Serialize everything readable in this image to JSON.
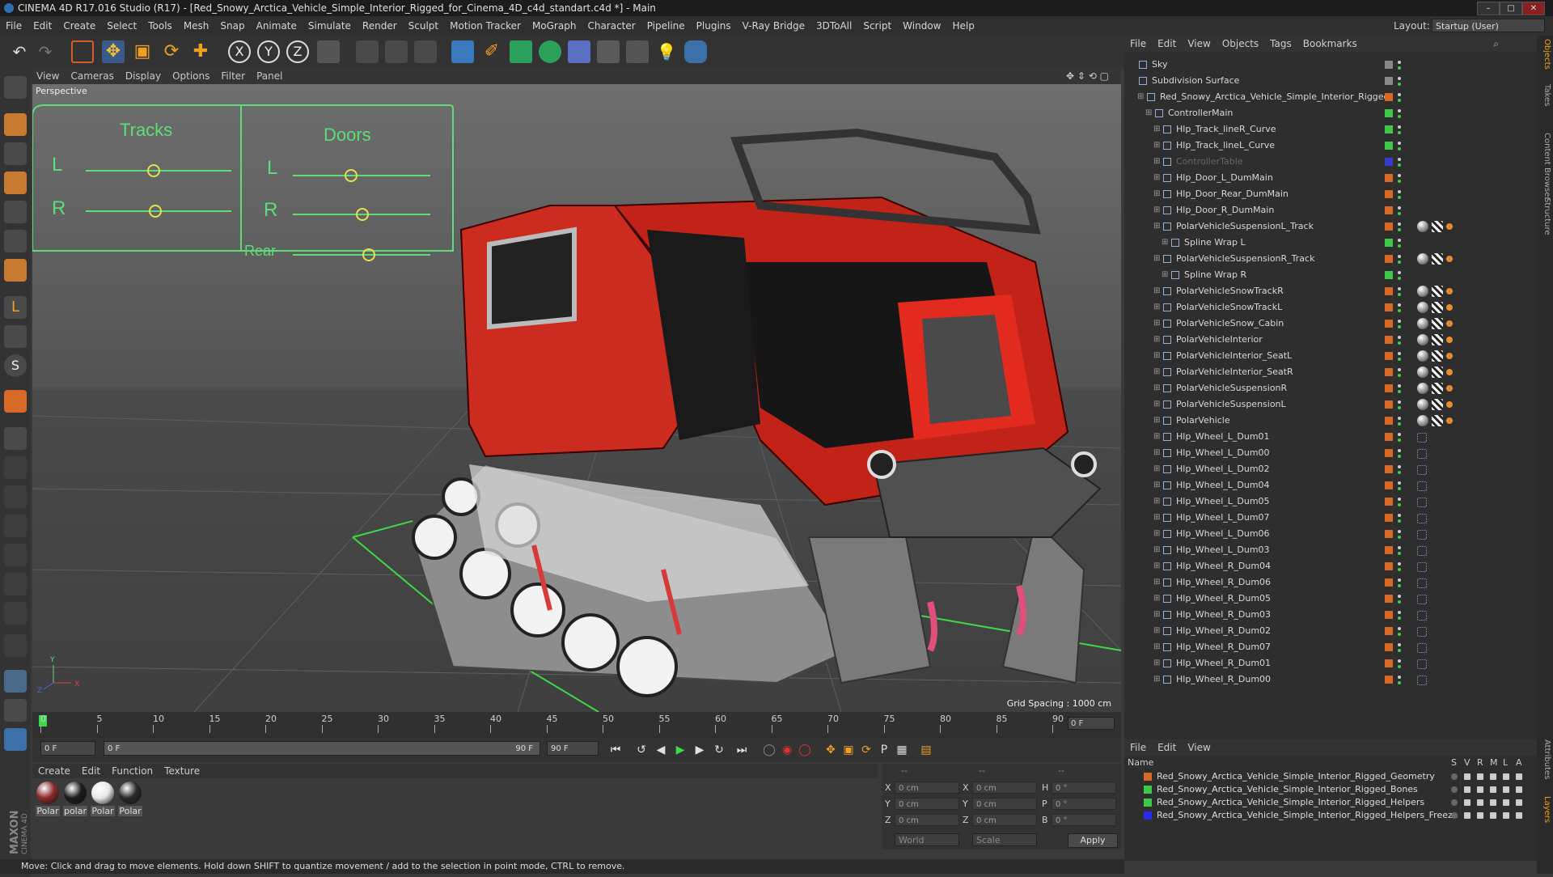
{
  "window": {
    "title": "CINEMA 4D R17.016 Studio (R17) - [Red_Snowy_Arctica_Vehicle_Simple_Interior_Rigged_for_Cinema_4D_c4d_standart.c4d *] - Main"
  },
  "menu": [
    "File",
    "Edit",
    "Create",
    "Select",
    "Tools",
    "Mesh",
    "Snap",
    "Animate",
    "Simulate",
    "Render",
    "Sculpt",
    "Motion Tracker",
    "MoGraph",
    "Character",
    "Pipeline",
    "Plugins",
    "V-Ray Bridge",
    "3DToAll",
    "Script",
    "Window",
    "Help"
  ],
  "layout": {
    "label": "Layout:",
    "value": "Startup (User)"
  },
  "axis_buttons": [
    "X",
    "Y",
    "Z"
  ],
  "viewport": {
    "menu": [
      "View",
      "Cameras",
      "Display",
      "Options",
      "Filter",
      "Panel"
    ],
    "label": "Perspective",
    "grid_spacing": "Grid Spacing : 1000 cm",
    "controller": {
      "tracks_title": "Tracks",
      "doors_title": "Doors",
      "tracks_l": "L",
      "tracks_r": "R",
      "doors_l": "L",
      "doors_r": "R",
      "doors_rear": "Rear"
    }
  },
  "timeline": {
    "ticks": [
      "0",
      "5",
      "10",
      "15",
      "20",
      "25",
      "30",
      "35",
      "40",
      "45",
      "50",
      "55",
      "60",
      "65",
      "70",
      "75",
      "80",
      "85",
      "90"
    ],
    "current_frame": "0 F",
    "start_field": "0 F",
    "range_start": "0 F",
    "range_end": "90 F",
    "end_field": "90 F"
  },
  "material_manager": {
    "menu": [
      "Create",
      "Edit",
      "Function",
      "Texture"
    ],
    "materials": [
      {
        "name": "Polar",
        "color": "#8a2a2a"
      },
      {
        "name": "polar",
        "color": "#1c1c1c"
      },
      {
        "name": "Polar",
        "color": "#e8e8e8"
      },
      {
        "name": "Polar",
        "color": "#2a2a2a"
      }
    ]
  },
  "coordinates": {
    "header": [
      "--",
      "--",
      "--"
    ],
    "rows": [
      {
        "a": "X",
        "av": "0 cm",
        "b": "X",
        "bv": "0 cm",
        "c": "H",
        "cv": "0 °"
      },
      {
        "a": "Y",
        "av": "0 cm",
        "b": "Y",
        "bv": "0 cm",
        "c": "P",
        "cv": "0 °"
      },
      {
        "a": "Z",
        "av": "0 cm",
        "b": "Z",
        "bv": "0 cm",
        "c": "B",
        "cv": "0 °"
      }
    ],
    "mode": "World",
    "type": "Scale",
    "apply": "Apply"
  },
  "object_manager": {
    "menu": [
      "File",
      "Edit",
      "View",
      "Objects",
      "Tags",
      "Bookmarks"
    ],
    "objects": [
      {
        "name": "Sky",
        "indent": 0,
        "color": "#888888"
      },
      {
        "name": "Subdivision Surface",
        "indent": 0,
        "color": "#888888"
      },
      {
        "name": "Red_Snowy_Arctica_Vehicle_Simple_Interior_Rigged",
        "indent": 1,
        "color": "#d86a28"
      },
      {
        "name": "ControllerMain",
        "indent": 2,
        "color": "#3ec84a"
      },
      {
        "name": "Hlp_Track_lineR_Curve",
        "indent": 3,
        "color": "#3ec84a"
      },
      {
        "name": "Hlp_Track_lineL_Curve",
        "indent": 3,
        "color": "#3ec84a"
      },
      {
        "name": "ControllerTable",
        "indent": 3,
        "color": "#3a3acc"
      },
      {
        "name": "Hlp_Door_L_DumMain",
        "indent": 3,
        "color": "#d86a28"
      },
      {
        "name": "Hlp_Door_Rear_DumMain",
        "indent": 3,
        "color": "#d86a28"
      },
      {
        "name": "Hlp_Door_R_DumMain",
        "indent": 3,
        "color": "#d86a28"
      },
      {
        "name": "PolarVehicleSuspensionL_Track",
        "indent": 3,
        "color": "#d86a28"
      },
      {
        "name": "Spline Wrap L",
        "indent": 4,
        "color": "#3ec84a"
      },
      {
        "name": "PolarVehicleSuspensionR_Track",
        "indent": 3,
        "color": "#d86a28"
      },
      {
        "name": "Spline Wrap R",
        "indent": 4,
        "color": "#3ec84a"
      },
      {
        "name": "PolarVehicleSnowTrackR",
        "indent": 3,
        "color": "#d86a28"
      },
      {
        "name": "PolarVehicleSnowTrackL",
        "indent": 3,
        "color": "#d86a28"
      },
      {
        "name": "PolarVehicleSnow_Cabin",
        "indent": 3,
        "color": "#d86a28"
      },
      {
        "name": "PolarVehicleInterior",
        "indent": 3,
        "color": "#d86a28"
      },
      {
        "name": "PolarVehicleInterior_SeatL",
        "indent": 3,
        "color": "#d86a28"
      },
      {
        "name": "PolarVehicleInterior_SeatR",
        "indent": 3,
        "color": "#d86a28"
      },
      {
        "name": "PolarVehicleSuspensionR",
        "indent": 3,
        "color": "#d86a28"
      },
      {
        "name": "PolarVehicleSuspensionL",
        "indent": 3,
        "color": "#d86a28"
      },
      {
        "name": "PolarVehicle",
        "indent": 3,
        "color": "#d86a28"
      },
      {
        "name": "Hlp_Wheel_L_Dum01",
        "indent": 3,
        "color": "#d86a28"
      },
      {
        "name": "Hlp_Wheel_L_Dum00",
        "indent": 3,
        "color": "#d86a28"
      },
      {
        "name": "Hlp_Wheel_L_Dum02",
        "indent": 3,
        "color": "#d86a28"
      },
      {
        "name": "Hlp_Wheel_L_Dum04",
        "indent": 3,
        "color": "#d86a28"
      },
      {
        "name": "Hlp_Wheel_L_Dum05",
        "indent": 3,
        "color": "#d86a28"
      },
      {
        "name": "Hlp_Wheel_L_Dum07",
        "indent": 3,
        "color": "#d86a28"
      },
      {
        "name": "Hlp_Wheel_L_Dum06",
        "indent": 3,
        "color": "#d86a28"
      },
      {
        "name": "Hlp_Wheel_L_Dum03",
        "indent": 3,
        "color": "#d86a28"
      },
      {
        "name": "Hlp_Wheel_R_Dum04",
        "indent": 3,
        "color": "#d86a28"
      },
      {
        "name": "Hlp_Wheel_R_Dum06",
        "indent": 3,
        "color": "#d86a28"
      },
      {
        "name": "Hlp_Wheel_R_Dum05",
        "indent": 3,
        "color": "#d86a28"
      },
      {
        "name": "Hlp_Wheel_R_Dum03",
        "indent": 3,
        "color": "#d86a28"
      },
      {
        "name": "Hlp_Wheel_R_Dum02",
        "indent": 3,
        "color": "#d86a28"
      },
      {
        "name": "Hlp_Wheel_R_Dum07",
        "indent": 3,
        "color": "#d86a28"
      },
      {
        "name": "Hlp_Wheel_R_Dum01",
        "indent": 3,
        "color": "#d86a28"
      },
      {
        "name": "Hlp_Wheel_R_Dum00",
        "indent": 3,
        "color": "#d86a28"
      }
    ]
  },
  "layer_manager": {
    "menu": [
      "File",
      "Edit",
      "View"
    ],
    "columns": [
      "Name",
      "S",
      "V",
      "R",
      "M",
      "L",
      "A"
    ],
    "layers": [
      {
        "name": "Red_Snowy_Arctica_Vehicle_Simple_Interior_Rigged_Geometry",
        "color": "#d86a28"
      },
      {
        "name": "Red_Snowy_Arctica_Vehicle_Simple_Interior_Rigged_Bones",
        "color": "#3ec84a"
      },
      {
        "name": "Red_Snowy_Arctica_Vehicle_Simple_Interior_Rigged_Helpers",
        "color": "#3ec84a"
      },
      {
        "name": "Red_Snowy_Arctica_Vehicle_Simple_Interior_Rigged_Helpers_Freeze",
        "color": "#2a2aee"
      }
    ]
  },
  "side_tabs": [
    "Objects",
    "Takes",
    "Content Browser",
    "Structure",
    "Attributes",
    "Layers"
  ],
  "status": "Move: Click and drag to move elements. Hold down SHIFT to quantize movement / add to the selection in point mode, CTRL to remove.",
  "brand": "MAXON CINEMA 4D"
}
